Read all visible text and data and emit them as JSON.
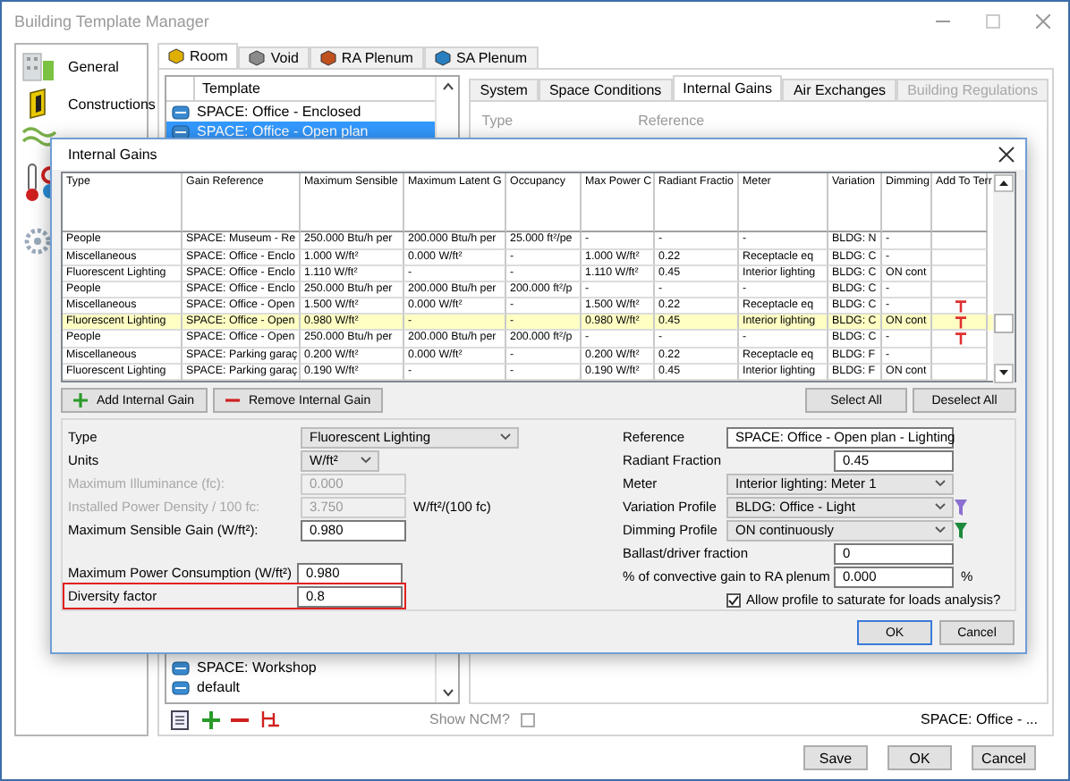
{
  "window": {
    "title": "Building Template Manager"
  },
  "sidebar": {
    "items": [
      {
        "label": "General"
      },
      {
        "label": "Constructions"
      }
    ]
  },
  "space_tabs": [
    {
      "label": "Room",
      "selected": true,
      "color": "#e0b000"
    },
    {
      "label": "Void",
      "selected": false,
      "color": "#8a8a8a"
    },
    {
      "label": "RA Plenum",
      "selected": false,
      "color": "#c0501e"
    },
    {
      "label": "SA Plenum",
      "selected": false,
      "color": "#2a7fc0"
    }
  ],
  "template_list": {
    "column": "Template",
    "upper_rows": [
      {
        "label": "SPACE: Office - Enclosed",
        "selected": false
      },
      {
        "label": "SPACE: Office - Open plan",
        "selected": true
      }
    ],
    "lower_rows": [
      {
        "label": "SPACE: Workshop",
        "selected": false
      },
      {
        "label": "default",
        "selected": false
      }
    ]
  },
  "detail_tabs": [
    {
      "label": "System",
      "selected": false,
      "disabled": false
    },
    {
      "label": "Space Conditions",
      "selected": false,
      "disabled": false
    },
    {
      "label": "Internal Gains",
      "selected": true,
      "disabled": false
    },
    {
      "label": "Air Exchanges",
      "selected": false,
      "disabled": false
    },
    {
      "label": "Building Regulations",
      "selected": false,
      "disabled": true
    }
  ],
  "detail_labels": [
    "Type",
    "Reference"
  ],
  "show_ncm": {
    "label": "Show NCM?",
    "checked": false
  },
  "status_text": "SPACE: Office - ...",
  "buttons": [
    "Save",
    "OK",
    "Cancel"
  ],
  "dialog": {
    "title": "Internal Gains",
    "table": {
      "columns": [
        "Type",
        "Gain Reference",
        "Maximum Sensible",
        "Maximum Latent G",
        "Occupancy",
        "Max Power C",
        "Radiant Fractio",
        "Meter",
        "Variation",
        "Dimming",
        "Add To Terr"
      ],
      "rows": [
        {
          "cells": [
            "People",
            "SPACE: Museum - Re",
            "250.000 Btu/h per",
            "200.000 Btu/h per",
            "25.000 ft²/pe",
            "-",
            "-",
            "-",
            "BLDG: N",
            "-"
          ],
          "selected": false,
          "add_to_terminal": false
        },
        {
          "cells": [
            "Miscellaneous",
            "SPACE: Office - Enclo",
            "1.000 W/ft²",
            "0.000 W/ft²",
            "-",
            "1.000 W/ft²",
            "0.22",
            "Receptacle eq",
            "BLDG: C",
            "-"
          ],
          "selected": false,
          "add_to_terminal": false
        },
        {
          "cells": [
            "Fluorescent Lighting",
            "SPACE: Office - Enclo",
            "1.110 W/ft²",
            "-",
            "-",
            "1.110 W/ft²",
            "0.45",
            "Interior lighting",
            "BLDG: C",
            "ON cont"
          ],
          "selected": false,
          "add_to_terminal": false
        },
        {
          "cells": [
            "People",
            "SPACE: Office - Enclo",
            "250.000 Btu/h per",
            "200.000 Btu/h per",
            "200.000 ft²/p",
            "-",
            "-",
            "-",
            "BLDG: C",
            "-"
          ],
          "selected": false,
          "add_to_terminal": false
        },
        {
          "cells": [
            "Miscellaneous",
            "SPACE: Office - Open",
            "1.500 W/ft²",
            "0.000 W/ft²",
            "-",
            "1.500 W/ft²",
            "0.22",
            "Receptacle eq",
            "BLDG: C",
            "-"
          ],
          "selected": false,
          "add_to_terminal": true
        },
        {
          "cells": [
            "Fluorescent Lighting",
            "SPACE: Office - Open",
            "0.980 W/ft²",
            "-",
            "-",
            "0.980 W/ft²",
            "0.45",
            "Interior lighting",
            "BLDG: C",
            "ON cont"
          ],
          "selected": true,
          "add_to_terminal": true
        },
        {
          "cells": [
            "People",
            "SPACE: Office - Open",
            "250.000 Btu/h per",
            "200.000 Btu/h per",
            "200.000 ft²/p",
            "-",
            "-",
            "-",
            "BLDG: C",
            "-"
          ],
          "selected": false,
          "add_to_terminal": true
        },
        {
          "cells": [
            "Miscellaneous",
            "SPACE: Parking garaç",
            "0.200 W/ft²",
            "0.000 W/ft²",
            "-",
            "0.200 W/ft²",
            "0.22",
            "Receptacle eq",
            "BLDG: F",
            "-"
          ],
          "selected": false,
          "add_to_terminal": false
        },
        {
          "cells": [
            "Fluorescent Lighting",
            "SPACE: Parking garaç",
            "0.190 W/ft²",
            "-",
            "-",
            "0.190 W/ft²",
            "0.45",
            "Interior lighting",
            "BLDG: F",
            "ON cont"
          ],
          "selected": false,
          "add_to_terminal": false
        }
      ]
    },
    "add_button": "Add Internal Gain",
    "remove_button": "Remove Internal Gain",
    "select_all": "Select All",
    "deselect_all": "Deselect All",
    "fields": [
      {
        "kind": "dropdown",
        "label": "Type",
        "value": "Fluorescent Lighting",
        "disabled": false
      },
      {
        "kind": "unitdropdown",
        "label": "Units",
        "value": "W/ft²",
        "disabled": false
      },
      {
        "kind": "text",
        "label": "Maximum Illuminance (fc):",
        "value": "0.000",
        "disabled": true
      },
      {
        "kind": "text",
        "label": "Installed Power Density / 100 fc:",
        "value": "3.750",
        "disabled": true,
        "unit": "W/ft²/(100 fc)"
      },
      {
        "kind": "text",
        "label": "Maximum Sensible Gain (W/ft²):",
        "value": "0.980",
        "disabled": false
      }
    ],
    "power_fields": [
      {
        "label": "Maximum Power Consumption (W/ft²)",
        "value": "0.980",
        "highlighted": false
      },
      {
        "label": "Diversity factor",
        "value": "0.8",
        "highlighted": true
      }
    ],
    "right_fields": [
      {
        "kind": "text",
        "label": "Reference",
        "value": "SPACE: Office - Open plan - Lighting"
      },
      {
        "kind": "short",
        "label": "Radiant Fraction",
        "value": "0.45"
      },
      {
        "kind": "dropdown",
        "label": "Meter",
        "value": "Interior lighting: Meter 1"
      },
      {
        "kind": "filterdropdown",
        "label": "Variation Profile",
        "value": "BLDG: Office - Light",
        "color": "#8a6fd0"
      },
      {
        "kind": "filterdropdown",
        "label": "Dimming Profile",
        "value": "ON continuously",
        "color": "#1e8a3c"
      },
      {
        "kind": "short",
        "label": "Ballast/driver fraction",
        "value": "0"
      },
      {
        "kind": "short",
        "label": "% of convective gain to RA plenum",
        "value": "0.000",
        "unit": "%"
      }
    ],
    "saturate": {
      "label": "Allow profile to saturate for loads analysis?",
      "checked": true
    },
    "ok": "OK",
    "cancel": "Cancel"
  }
}
